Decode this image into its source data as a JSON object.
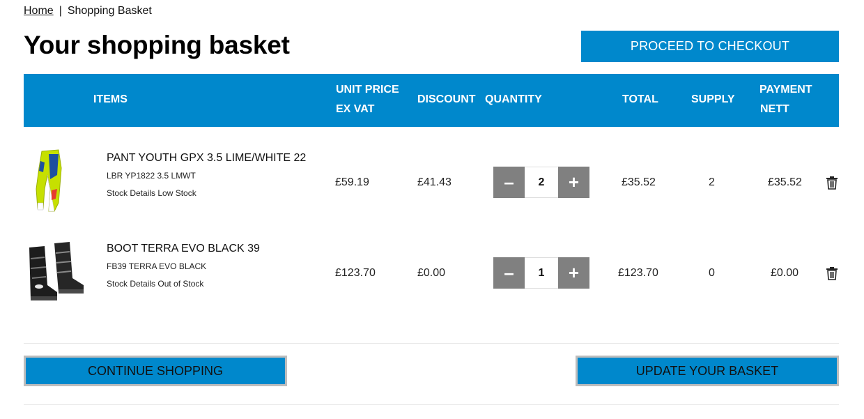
{
  "breadcrumb": {
    "home": "Home",
    "separator": "|",
    "current": "Shopping Basket"
  },
  "page_title": "Your shopping basket",
  "checkout_button": "PROCEED TO CHECKOUT",
  "table": {
    "headers": {
      "items": "ITEMS",
      "unit_price_line1": "UNIT PRICE",
      "unit_price_line2": "EX VAT",
      "discount": "DISCOUNT",
      "quantity": "QUANTITY",
      "total": "TOTAL",
      "supply": "SUPPLY",
      "payment_line1": "PAYMENT",
      "payment_line2": "NETT"
    },
    "rows": [
      {
        "name": "PANT YOUTH GPX 3.5 LIME/WHITE 22",
        "code": "LBR YP1822 3.5 LMWT",
        "stock": "Stock Details Low Stock",
        "unit_price": "£59.19",
        "discount": "£41.43",
        "quantity": "2",
        "total": "£35.52",
        "supply": "2",
        "payment": "£35.52"
      },
      {
        "name": "BOOT TERRA EVO BLACK 39",
        "code": "FB39 TERRA EVO BLACK",
        "stock": "Stock Details Out of Stock",
        "unit_price": "£123.70",
        "discount": "£0.00",
        "quantity": "1",
        "total": "£123.70",
        "supply": "0",
        "payment": "£0.00"
      }
    ],
    "minus_symbol": "–",
    "plus_symbol": "+"
  },
  "continue_button": "CONTINUE SHOPPING",
  "update_button": "UPDATE YOUR BASKET",
  "colors": {
    "accent": "#0088cc",
    "stepper": "#808080",
    "outline": "#bdbdbd"
  },
  "icons": {
    "delete": "trash-icon"
  }
}
